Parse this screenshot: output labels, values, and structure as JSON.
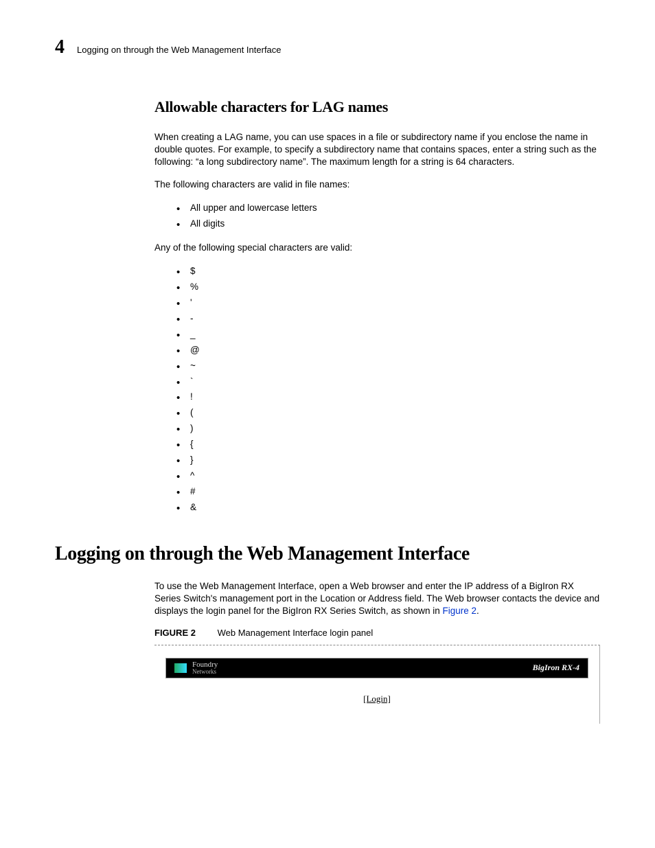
{
  "header": {
    "chapter": "4",
    "title": "Logging on through the Web Management Interface"
  },
  "section1": {
    "heading": "Allowable characters for LAG names",
    "p1": "When creating a LAG name, you can use spaces in a file or subdirectory name if you enclose the name in double quotes. For example, to specify a subdirectory name that contains spaces, enter a string such as the following: “a long subdirectory name”. The maximum length for a string is 64 characters.",
    "p2": "The following characters are valid in file names:",
    "valid_list": {
      "i1": "All upper and lowercase letters",
      "i2": "All digits"
    },
    "p3": "Any of the following special characters are valid:",
    "special_chars": {
      "c1": "$",
      "c2": "%",
      "c3": "'",
      "c4": "-",
      "c5": "_",
      "c6": "@",
      "c7": "~",
      "c8": "`",
      "c9": "!",
      "c10": "(",
      "c11": ")",
      "c12": "{",
      "c13": "}",
      "c14": "^",
      "c15": "#",
      "c16": "&"
    }
  },
  "section2": {
    "heading": "Logging on through the Web Management Interface",
    "p1_a": "To use the Web Management Interface, open a Web browser and enter the IP address of a BigIron RX Series Switch's management port in the Location or Address field. The Web browser contacts the device and displays the login panel for the BigIron RX Series Switch, as shown in ",
    "p1_link": "Figure 2",
    "p1_b": ".",
    "figure_label_num": "FIGURE 2",
    "figure_label_text": "Web Management Interface login panel",
    "banner": {
      "brand_line1": "Foundry",
      "brand_line2": "Networks",
      "model": "BigIron RX-4"
    },
    "login_text": "[Login]"
  }
}
